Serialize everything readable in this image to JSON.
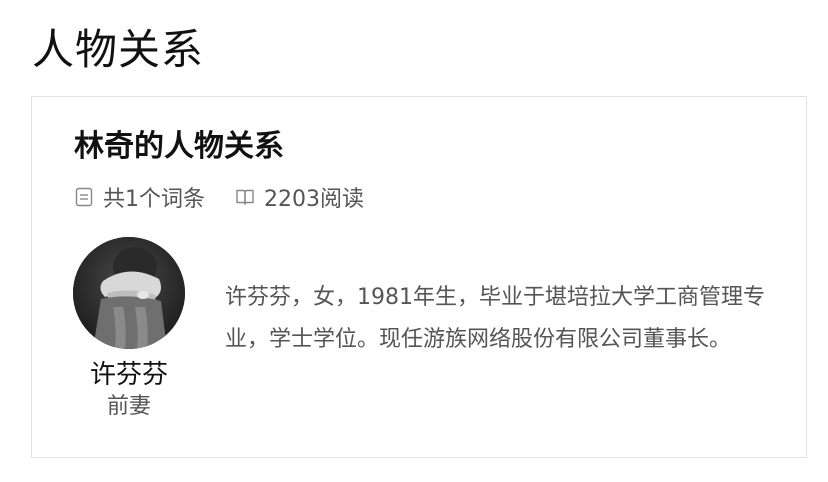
{
  "section": {
    "title": "人物关系"
  },
  "card": {
    "title": "林奇的人物关系",
    "meta": {
      "entries_text": "共1个词条",
      "entries_icon": "document-icon",
      "reads_text": "2203阅读",
      "reads_icon": "book-icon"
    },
    "person": {
      "name": "许芬芬",
      "relation": "前妻",
      "description": "许芬芬，女，1981年生，毕业于堪培拉大学工商管理专业，学士学位。现任游族网络股份有限公司董事长。"
    }
  },
  "colors": {
    "text_primary": "#111111",
    "text_secondary": "#555555",
    "border": "#e2e2e2"
  }
}
